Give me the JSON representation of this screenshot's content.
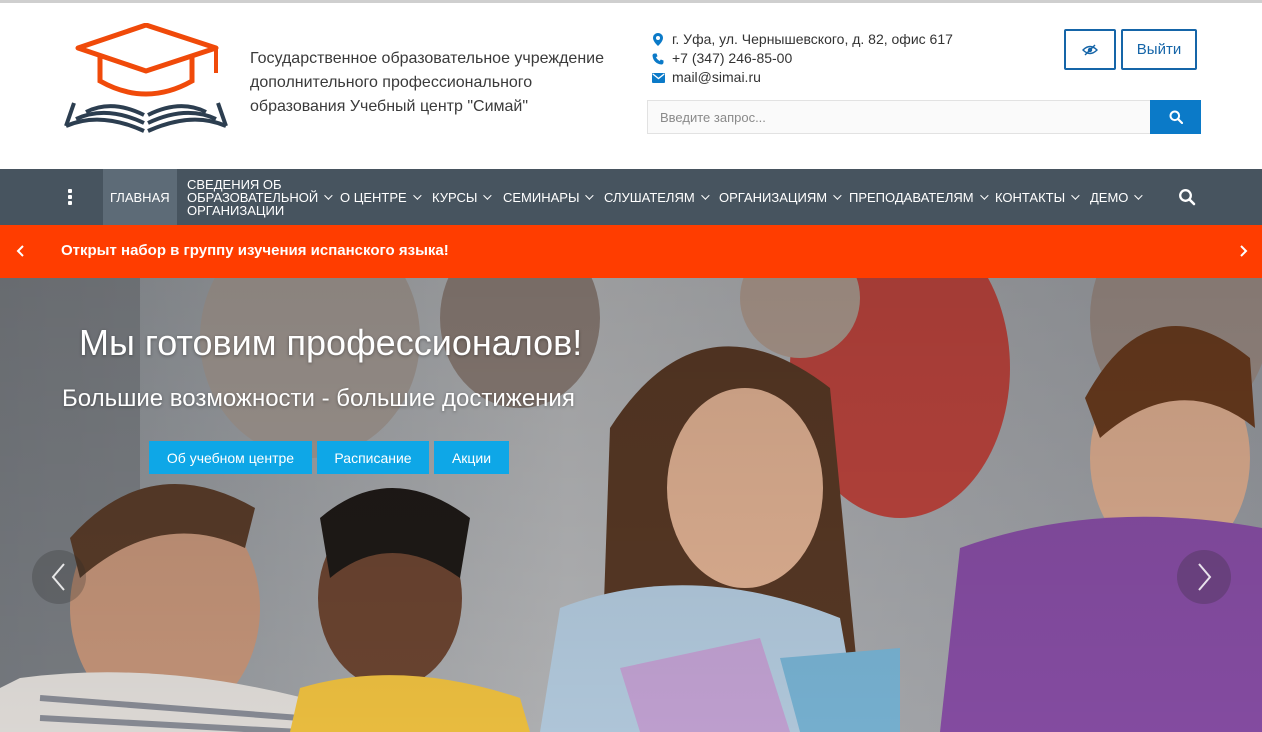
{
  "header": {
    "org_name_line1": "Государственное образовательное учреждение",
    "org_name_line2": "дополнительного профессионального",
    "org_name_line3": "образования Учебный центр \"Симай\"",
    "address": "г. Уфа, ул. Чернышевского, д. 82, офис 617",
    "phone": "+7 (347) 246-85-00",
    "email": "mail@simai.ru",
    "exit_label": "Выйти",
    "search_placeholder": "Введите запрос..."
  },
  "nav": {
    "items": [
      {
        "label": "ГЛАВНАЯ"
      },
      {
        "label_line1": "СВЕДЕНИЯ ОБ",
        "label_line2": "ОБРАЗОВАТЕЛЬНОЙ",
        "label_line3": "ОРГАНИЗАЦИИ"
      },
      {
        "label": "О ЦЕНТРЕ"
      },
      {
        "label": "КУРСЫ"
      },
      {
        "label": "СЕМИНАРЫ"
      },
      {
        "label": "СЛУШАТЕЛЯМ"
      },
      {
        "label": "ОРГАНИЗАЦИЯМ"
      },
      {
        "label": "ПРЕПОДАВАТЕЛЯМ"
      },
      {
        "label": "КОНТАКТЫ"
      },
      {
        "label": "ДЕМО"
      }
    ]
  },
  "ticker": {
    "message": "Открыт набор в группу изучения испанского языка!"
  },
  "hero": {
    "title": "Мы готовим профессионалов!",
    "subtitle": "Большие возможности - большие достижения",
    "buttons": [
      "Об учебном центре",
      "Расписание",
      "Акции"
    ]
  },
  "colors": {
    "nav_bg": "#47545f",
    "ticker_bg": "#ff3d00",
    "accent_blue": "#0b7ac8",
    "hero_button": "#0ea7e7",
    "logo_orange": "#f04a0a",
    "logo_dark": "#2c3e50"
  },
  "icons": [
    "map-marker-icon",
    "phone-icon",
    "envelope-icon",
    "eye-slash-icon",
    "search-icon",
    "kebab-menu-icon",
    "chevron-left-icon",
    "chevron-right-icon",
    "graduation-cap-book-logo"
  ]
}
